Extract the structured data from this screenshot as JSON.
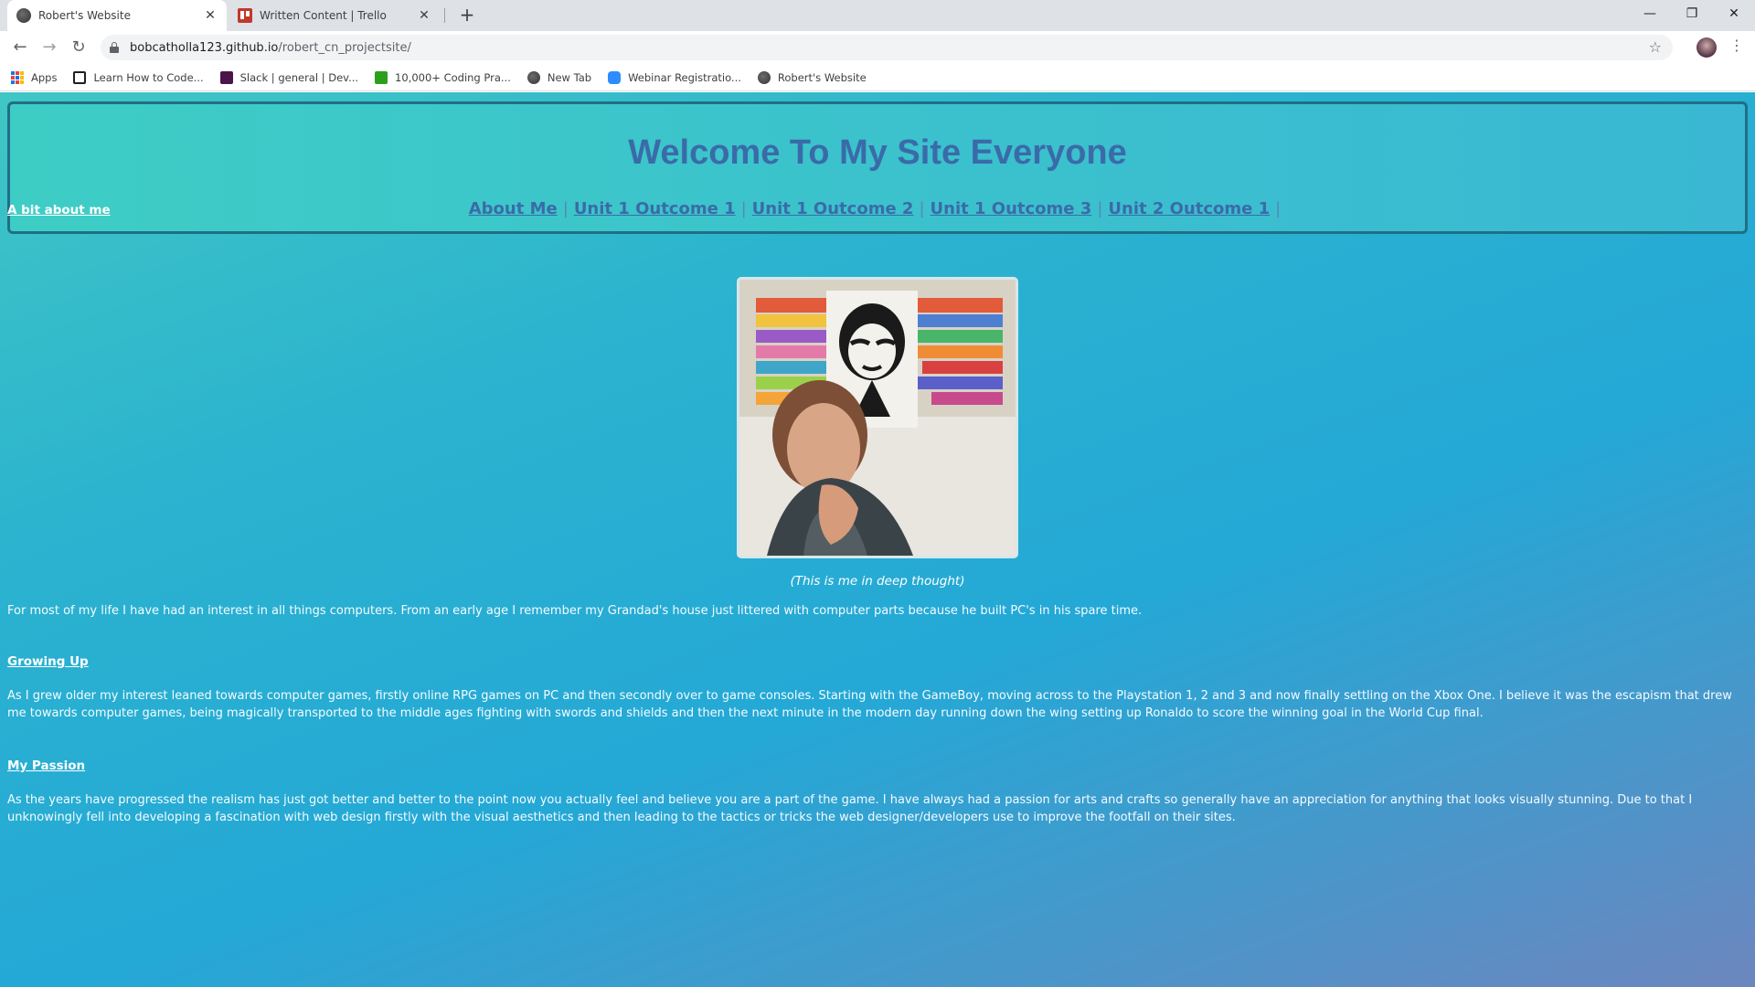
{
  "browser": {
    "tabs": [
      {
        "title": "Robert's Website",
        "active": true,
        "icon": "globe-icon"
      },
      {
        "title": "Written Content | Trello",
        "active": false,
        "icon": "trello-icon"
      }
    ],
    "url_domain": "bobcatholla123.github.io",
    "url_path": "/robert_cn_projectsite/",
    "bookmarks": [
      {
        "label": "Apps",
        "icon": "apps-grid-icon"
      },
      {
        "label": "Learn How to Code...",
        "icon": "codecademy-icon"
      },
      {
        "label": "Slack | general | Dev...",
        "icon": "slack-icon"
      },
      {
        "label": "10,000+ Coding Pra...",
        "icon": "practice-icon"
      },
      {
        "label": "New Tab",
        "icon": "globe-icon"
      },
      {
        "label": "Webinar Registratio...",
        "icon": "zoom-icon"
      },
      {
        "label": "Robert's Website",
        "icon": "globe-icon"
      }
    ]
  },
  "site": {
    "title": "Welcome To My Site Everyone",
    "nav": [
      "About Me",
      "Unit 1 Outcome 1",
      "Unit 1 Outcome 2",
      "Unit 1 Outcome 3",
      "Unit 2 Outcome 1"
    ],
    "nav_separator": "|",
    "sections": {
      "about_heading": "A bit about me",
      "photo_caption": "(This is me in deep thought)",
      "about_text": "For most of my life I have had an interest in all things computers. From an early age I remember my Grandad's house just littered with computer parts because he built PC's in his spare time.",
      "growing_heading": "Growing Up",
      "growing_text": "As I grew older my interest leaned towards computer games, firstly online RPG games on PC and then secondly over to game consoles. Starting with the GameBoy, moving across to the Playstation 1, 2 and 3 and now finally settling on the Xbox One. I believe it was the escapism that drew me towards computer games, being magically transported to the middle ages fighting with swords and shields and then the next minute in the modern day running down the wing setting up Ronaldo to score the winning goal in the World Cup final.",
      "passion_heading": "My Passion",
      "passion_text": "As the years have progressed the realism has just got better and better to the point now you actually feel and believe you are a part of the game. I have always had a passion for arts and crafts so generally have an appreciation for anything that looks visually stunning. Due to that I unknowingly fell into developing a fascination with web design firstly with the visual aesthetics and then leading to the tactics or tricks the web designer/developers use to improve the footfall on their sites."
    }
  },
  "colors": {
    "page_gradient_start": "#40c6c4",
    "page_gradient_end": "#6d86bf",
    "title_color": "#3a6ba8",
    "header_border": "#1f6f85"
  }
}
